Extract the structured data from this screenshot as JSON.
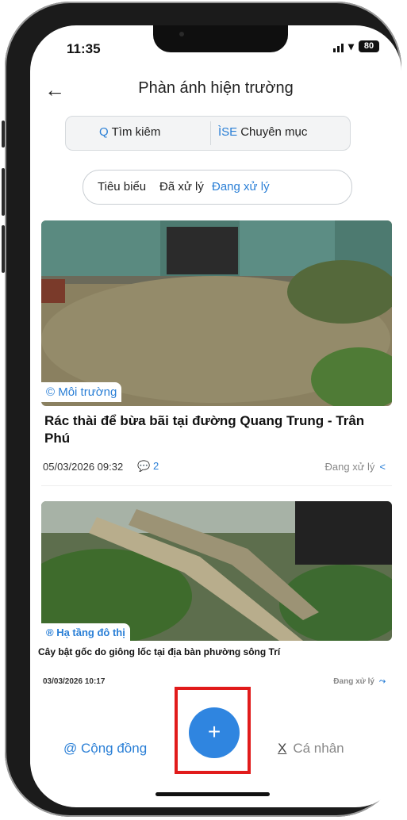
{
  "status_bar": {
    "time": "11:35",
    "battery": "80"
  },
  "header": {
    "title": "Phàn ánh hiện trường"
  },
  "search": {
    "search_icon": "Q",
    "search_label": "Tìm kiêm",
    "category_icon": "ÌSE",
    "category_label": "Chuyên mục"
  },
  "filters": [
    "Tiêu biểu",
    "Đã xử lý",
    "Đang xử lý"
  ],
  "posts": [
    {
      "category": "© Môi trường",
      "title": "Rác thài để bừa bãi tại đường Quang Trung - Trân Phú",
      "datetime": "05/03/2026 09:32",
      "comments": "2",
      "status": "Đang xử lý",
      "share_icon": "<"
    },
    {
      "category": "® Hạ tầng đô thị",
      "title": "Cây bật gốc do giông lốc tại địa bàn phường sông Trí",
      "datetime": "03/03/2026 10:17",
      "status": "Đang xử lý",
      "share_icon": "share-icon"
    }
  ],
  "bottom_nav": {
    "left_label": "@ Cộng đồng",
    "right_icon": "X",
    "right_label": "Cá nhân",
    "fab_icon": "+"
  }
}
